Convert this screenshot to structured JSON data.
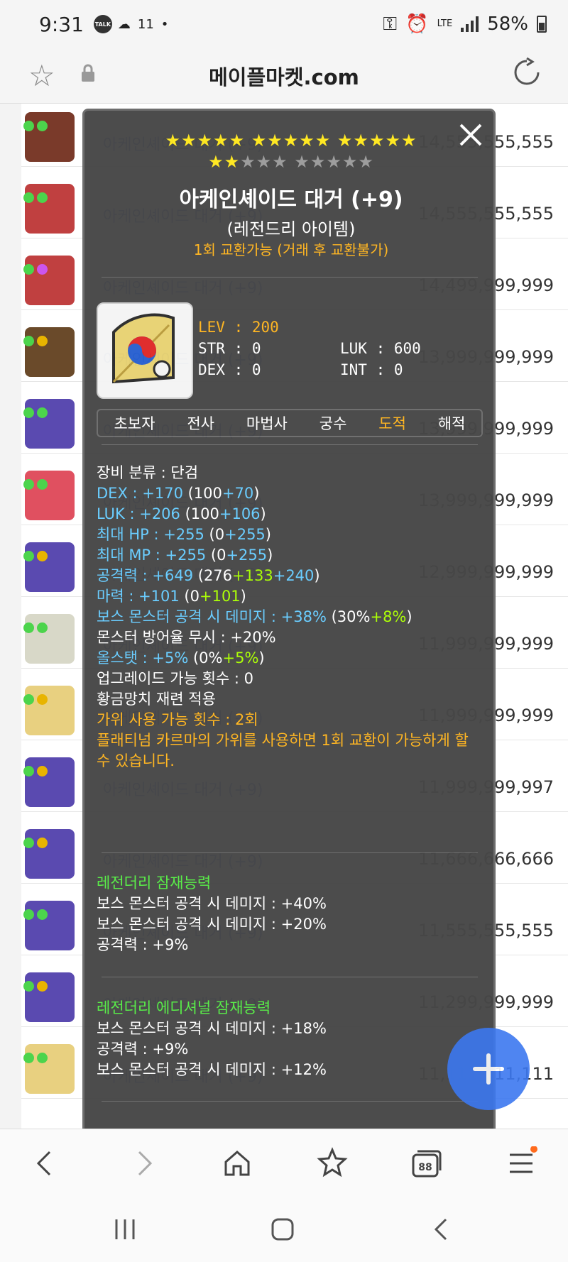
{
  "status": {
    "time": "9:31",
    "talk": "TALK",
    "extra": "11",
    "battery": "58%",
    "network": "LTE"
  },
  "browser": {
    "domain": "메이플마켓.com"
  },
  "list": [
    {
      "name": "아케인셰이드 대거 (+9)",
      "price": "14,555,555,555",
      "dots": [
        "#4cd44c",
        "#4cd44c"
      ],
      "thumb": "#7a3a2a"
    },
    {
      "name": "아케인셰이드 대거 (+9)",
      "price": "14,555,555,555",
      "dots": [
        "#4cd44c",
        "#4cd44c"
      ],
      "thumb": "#c04040"
    },
    {
      "name": "아케인셰이드 대거 (+9)",
      "price": "14,499,999,999",
      "dots": [
        "#4cd44c",
        "#cc55ee"
      ],
      "thumb": "#c04040"
    },
    {
      "name": "아케인셰이드 대거 (+9)",
      "price": "13,999,999,999",
      "dots": [
        "#4cd44c",
        "#e8b400"
      ],
      "thumb": "#6a4a2a"
    },
    {
      "name": "아케인셰이드 대거 (+9)",
      "price": "13,999,999,999",
      "dots": [
        "#4cd44c",
        "#4cd44c"
      ],
      "thumb": "#5a4ab0"
    },
    {
      "name": "아케인셰이드 대거 (+9)",
      "price": "13,999,999,999",
      "dots": [
        "#4cd44c",
        "#4cd44c"
      ],
      "thumb": "#e05060"
    },
    {
      "name": "아케인셰이드 대거 (+9)",
      "price": "12,999,999,999",
      "dots": [
        "#4cd44c",
        "#e8b400"
      ],
      "thumb": "#5a4ab0"
    },
    {
      "name": "아케인셰이드 대거 (+9)",
      "price": "11,999,999,999",
      "dots": [
        "#4cd44c",
        "#4cd44c"
      ],
      "thumb": "#d8d8c8"
    },
    {
      "name": "아케인셰이드 대거 (+9)",
      "price": "11,999,999,999",
      "dots": [
        "#4cd44c",
        "#e8b400"
      ],
      "thumb": "#e8d080"
    },
    {
      "name": "아케인셰이드 대거 (+9)",
      "price": "11,999,999,997",
      "dots": [
        "#4cd44c",
        "#e8b400"
      ],
      "thumb": "#5a4ab0"
    },
    {
      "name": "아케인셰이드 대거 (+9)",
      "price": "11,666,666,666",
      "dots": [
        "#4cd44c",
        "#e8b400"
      ],
      "thumb": "#5a4ab0"
    },
    {
      "name": "아케인셰이드 대거 (+9)",
      "price": "11,555,555,555",
      "dots": [
        "#4cd44c",
        "#4cd44c"
      ],
      "thumb": "#5a4ab0"
    },
    {
      "name": "아케인셰이드 대거 (+9)",
      "price": "11,299,999,999",
      "dots": [
        "#4cd44c",
        "#e8b400"
      ],
      "thumb": "#5a4ab0"
    },
    {
      "name": "아케인셰이드 대거 (+9)",
      "price": "11,111,111,111",
      "dots": [
        "#4cd44c",
        "#4cd44c"
      ],
      "thumb": "#e8d080"
    }
  ],
  "modal": {
    "stars_row1_yellow": "★★★★★ ★★★★★ ★★★★★",
    "stars_row2_yellow": "★★",
    "stars_row2_gray": "★★★ ★★★★★",
    "title": "아케인셰이드 대거 (+9)",
    "grade": "(레전드리 아이템)",
    "exchange": "1회 교환가능 (거래 후 교환불가)",
    "lev": "LEV  : 200",
    "str": "STR  : 0",
    "dex": "DEX  : 0",
    "luk": "LUK  : 600",
    "int": "INT  : 0",
    "jobs": [
      "초보자",
      "전사",
      "마법사",
      "궁수",
      "도적",
      "해적"
    ],
    "lines": {
      "category": "장비 분류 : 단검",
      "dex_label": "DEX : +170",
      "dex_open": " (100",
      "dex_add": "+70",
      "dex_close": ")",
      "luk_label": "LUK : +206",
      "luk_open": " (100",
      "luk_add": "+106",
      "luk_close": ")",
      "hp_label": "최대 HP : +255",
      "hp_open": " (0",
      "hp_add": "+255",
      "hp_close": ")",
      "mp_label": "최대 MP : +255",
      "mp_open": " (0",
      "mp_add": "+255",
      "mp_close": ")",
      "atk_label": "공격력 : +649",
      "atk_open": " (276",
      "atk_add1": "+133",
      "atk_add2": "+240",
      "atk_close": ")",
      "mag_label": "마력 : +101",
      "mag_open": " (0",
      "mag_add": "+101",
      "mag_close": ")",
      "boss_label": "보스 몬스터 공격 시 데미지 : +38%",
      "boss_open": " (30%",
      "boss_add": "+8%",
      "boss_close": ")",
      "ignore": "몬스터 방어율 무시 : +20%",
      "allstat_label": "올스탯 : +5%",
      "allstat_open": " (0%",
      "allstat_add": "+5%",
      "allstat_close": ")",
      "upgrade": "업그레이드 가능 횟수 : 0",
      "hammer": "황금망치 재련 적용",
      "scissors": "가위 사용 가능 횟수 : 2회",
      "scissors_note": "플래티넘 카르마의 가위를 사용하면 1회 교환이 가능하게 할 수 있습니다."
    },
    "potential": {
      "title": "레전더리 잠재능력",
      "lines": [
        "보스 몬스터 공격 시 데미지 : +40%",
        "보스 몬스터 공격 시 데미지 : +20%",
        "공격력 : +9%"
      ]
    },
    "additional": {
      "title": "레전더리 에디셔널 잠재능력",
      "lines": [
        "보스 몬스터 공격 시 데미지 : +18%",
        "공격력 : +9%",
        "보스 몬스터 공격 시 데미지 : +12%"
      ]
    }
  },
  "bottom_nav": [
    "back-icon",
    "forward-icon",
    "home-icon",
    "bookmarks-icon",
    "tabs-icon",
    "menu-icon"
  ],
  "tabs_count": "88"
}
